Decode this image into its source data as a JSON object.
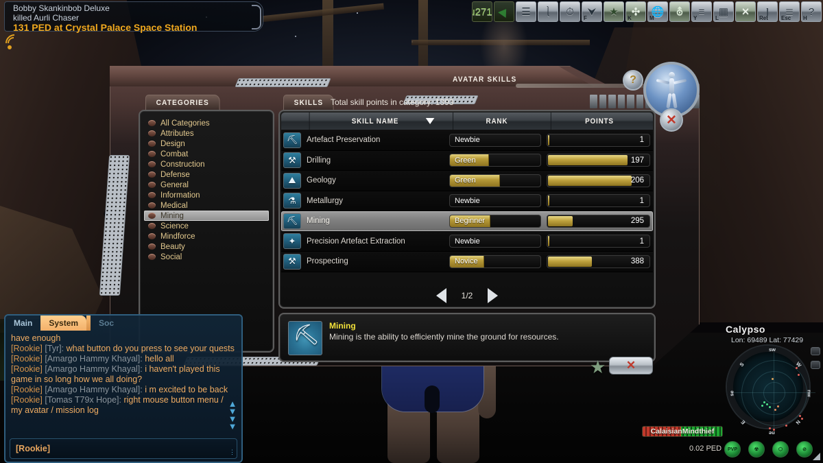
{
  "kill_banner": {
    "line1": "Bobby Skankinbob Deluxe",
    "line2": "killed Aurli Chaser",
    "line3": "131 PED at Crystal Palace Space Station"
  },
  "toolbar": {
    "items": [
      {
        "name": "tool-icon",
        "glyph": "✒",
        "key": ""
      },
      {
        "name": "teleport-icon",
        "glyph": "↗",
        "key": ""
      },
      {
        "name": "inventory-icon",
        "glyph": "☰",
        "key": ""
      },
      {
        "name": "storage-icon",
        "glyph": "▭",
        "key": ""
      },
      {
        "name": "auction-icon",
        "glyph": "⏱",
        "key": ""
      },
      {
        "name": "society-icon",
        "glyph": "⮟",
        "key": "F"
      },
      {
        "name": "favourites-star-icon",
        "glyph": "★",
        "key": ""
      },
      {
        "name": "avatar-skills-icon",
        "glyph": "✳",
        "key": "K"
      },
      {
        "name": "map-globe-icon",
        "glyph": "ἱ0",
        "key": "M"
      },
      {
        "name": "vehicle-icon",
        "glyph": "⛾",
        "key": ""
      },
      {
        "name": "mission-log-icon",
        "glyph": "≡",
        "key": "Y"
      },
      {
        "name": "window-layout-icon",
        "glyph": "▦",
        "key": "L"
      },
      {
        "name": "treasure-map-icon",
        "glyph": "✕",
        "key": ""
      },
      {
        "name": "chat-add-icon",
        "glyph": "⬬",
        "key": "Ret"
      },
      {
        "name": "escape-menu-icon",
        "glyph": "≡",
        "key": "Esc"
      },
      {
        "name": "help-mouse-icon",
        "glyph": "?",
        "key": "H"
      }
    ]
  },
  "skills_window": {
    "title": "AVATAR SKILLS",
    "help_label": "?",
    "close_label": "✕",
    "categories_tab": "CATEGORIES",
    "skills_tab": "SKILLS",
    "total_points_label": "Total skill points in category: 1393",
    "categories": [
      {
        "label": "All Categories",
        "selected": false
      },
      {
        "label": "Attributes",
        "selected": false
      },
      {
        "label": "Design",
        "selected": false
      },
      {
        "label": "Combat",
        "selected": false
      },
      {
        "label": "Construction",
        "selected": false
      },
      {
        "label": "Defense",
        "selected": false
      },
      {
        "label": "General",
        "selected": false
      },
      {
        "label": "Information",
        "selected": false
      },
      {
        "label": "Medical",
        "selected": false
      },
      {
        "label": "Mining",
        "selected": true
      },
      {
        "label": "Science",
        "selected": false
      },
      {
        "label": "Mindforce",
        "selected": false
      },
      {
        "label": "Beauty",
        "selected": false
      },
      {
        "label": "Social",
        "selected": false
      }
    ],
    "table": {
      "columns": [
        "",
        "SKILL NAME",
        "RANK",
        "POINTS"
      ],
      "sorted_column": "SKILL NAME",
      "sort_direction": "desc",
      "rows": [
        {
          "icon": "artefact-preservation-icon",
          "glyph": "⛏",
          "name": "Artefact Preservation",
          "rank": "Newbie",
          "rank_pct": 0,
          "points": 1,
          "points_pct": 1
        },
        {
          "icon": "drilling-icon",
          "glyph": "⚒",
          "name": "Drilling",
          "rank": "Green",
          "rank_pct": 43,
          "points": 197,
          "points_pct": 78
        },
        {
          "icon": "geology-icon",
          "glyph": "⛰",
          "name": "Geology",
          "rank": "Green",
          "rank_pct": 55,
          "points": 206,
          "points_pct": 82
        },
        {
          "icon": "metallurgy-icon",
          "glyph": "⚗",
          "name": "Metallurgy",
          "rank": "Newbie",
          "rank_pct": 0,
          "points": 1,
          "points_pct": 1
        },
        {
          "icon": "mining-icon",
          "glyph": "⛏",
          "name": "Mining",
          "rank": "Beginner",
          "rank_pct": 45,
          "points": 295,
          "points_pct": 24,
          "selected": true
        },
        {
          "icon": "precision-artefact-extraction-icon",
          "glyph": "✦",
          "name": "Precision Artefact Extraction",
          "rank": "Newbie",
          "rank_pct": 0,
          "points": 1,
          "points_pct": 1
        },
        {
          "icon": "prospecting-icon",
          "glyph": "⚒",
          "name": "Prospecting",
          "rank": "Novice",
          "rank_pct": 38,
          "points": 388,
          "points_pct": 43
        }
      ]
    },
    "pagination": {
      "prev": "◀",
      "page": "1/2",
      "next": "▶"
    },
    "description": {
      "icon": "mining-pickaxe-icon",
      "glyph": "⛏",
      "title": "Mining",
      "text": "Mining is the ability to efficiently mine the ground for resources."
    },
    "footer": {
      "favourite_star": "★",
      "close": "✕"
    }
  },
  "chat": {
    "tabs": [
      {
        "label": "Main",
        "active": false
      },
      {
        "label": "System",
        "active": true
      },
      {
        "label": "Soc",
        "active": false,
        "dim": true
      }
    ],
    "lines": [
      {
        "tag": "",
        "who": "",
        "msg": "have enough"
      },
      {
        "tag": "[Rookie]",
        "who": "[Tyr]:",
        "msg": "what button do you press to see your quests"
      },
      {
        "tag": "[Rookie]",
        "who": "[Amargo Hammy Khayal]:",
        "msg": "hello all"
      },
      {
        "tag": "[Rookie]",
        "who": "[Amargo Hammy Khayal]:",
        "msg": "i haven't played this game in so long how we all doing?"
      },
      {
        "tag": "[Rookie]",
        "who": "[Amargo Hammy Khayal]:",
        "msg": "i m excited to be back"
      },
      {
        "tag": "[Rookie]",
        "who": "[Tomas T79x Hope]:",
        "msg": "right mouse button menu / my avatar / mission log"
      }
    ],
    "input_prefix": "[Rookie]",
    "input_value": ""
  },
  "hud": {
    "planet": "Calypso",
    "coordinates": "Lon: 69489  Lat: 77429",
    "compass": [
      "sw",
      "S",
      "se",
      "E",
      "ne",
      "N",
      "nw",
      "W"
    ],
    "status_icons": [
      {
        "name": "pvp-status-icon",
        "label": "PVP"
      },
      {
        "name": "toxic-status-icon",
        "label": "☢"
      },
      {
        "name": "gravity-status-icon",
        "label": "⬡"
      },
      {
        "name": "no-entry-status-icon",
        "label": "⊘"
      }
    ]
  },
  "player": {
    "name": "CalaisianMindthief",
    "ped": "0.02 PED",
    "health_pct": 52
  },
  "colors": {
    "accent_gold": "#e0a820",
    "rank_bar": "#bfa23e",
    "chat_orange": "#e7a55e",
    "window_brown": "#5d4440",
    "radar_green": "#1fa832"
  }
}
